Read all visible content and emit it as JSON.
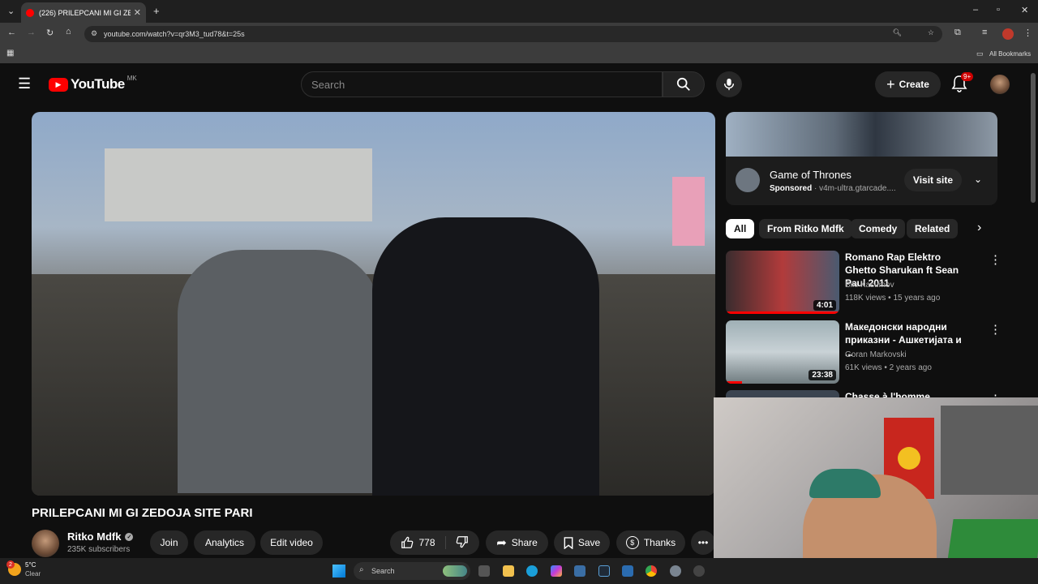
{
  "browser": {
    "tab_title": "(226) PRILEPCANI MI GI ZE…",
    "url": "youtube.com/watch?v=qr3M3_tud78&t=25s",
    "bookmarks_label": "All Bookmarks"
  },
  "youtube": {
    "logo_text": "YouTube",
    "region": "MK",
    "search_placeholder": "Search",
    "create_label": "Create",
    "notifications_badge": "9+",
    "video_title": "PRILEPCANI MI GI ZEDOJA SITE PARI",
    "channel_name": "Ritko Mdfk",
    "subscribers": "235K subscribers",
    "buttons": {
      "join": "Join",
      "analytics": "Analytics",
      "edit_video": "Edit video",
      "like_count": "778",
      "share": "Share",
      "save": "Save",
      "thanks": "Thanks"
    },
    "ad": {
      "title": "Game of Thrones",
      "sponsored": "Sponsored",
      "url": "v4m-ultra.gtarcade....",
      "cta": "Visit site"
    },
    "chips": [
      "All",
      "From Ritko Mdfk",
      "Comedy",
      "Related"
    ],
    "recommendations": [
      {
        "title": "Romano Rap Elektro Ghetto Sharukan ft Sean Paul 2011",
        "channel": "Biki Kasumov",
        "meta": "118K views • 15 years ago",
        "duration": "4:01"
      },
      {
        "title": "Македонски народни приказни - Ашкетијата и ...",
        "channel": "Goran Markovski",
        "meta": "61K views • 2 years ago",
        "duration": "23:38"
      },
      {
        "title": "Chasse à l'homme",
        "channel": "",
        "meta": "",
        "duration": ""
      }
    ]
  },
  "taskbar": {
    "weather_temp": "5°C",
    "weather_desc": "Clear",
    "search_placeholder": "Search",
    "weather_badge": "2"
  },
  "colors": {
    "youtube_red": "#ff0000",
    "background": "#0f0f0f"
  }
}
